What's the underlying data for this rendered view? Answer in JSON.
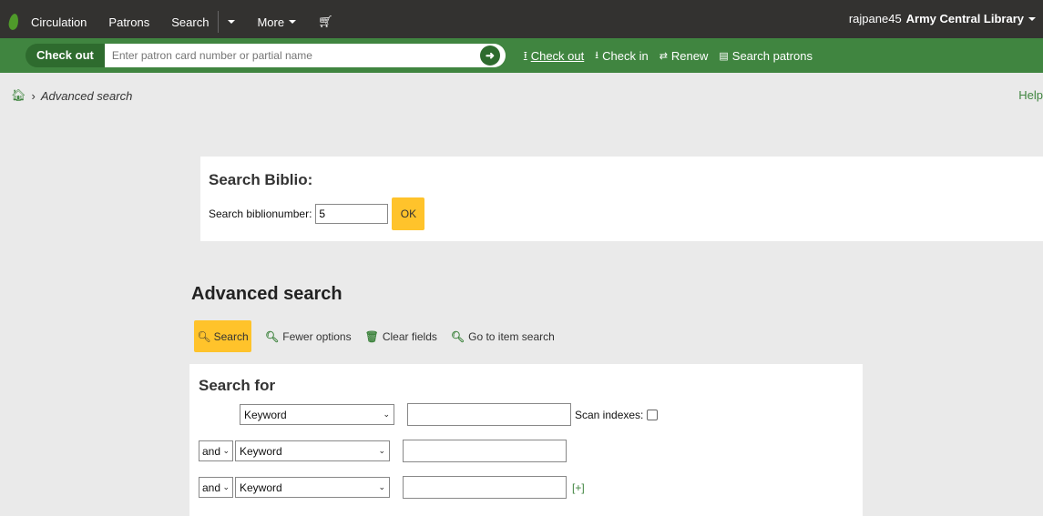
{
  "topnav": {
    "items": [
      {
        "label": "Circulation"
      },
      {
        "label": "Patrons"
      },
      {
        "label": "Search"
      }
    ],
    "more_label": "More",
    "user": "rajpane45",
    "library": "Army Central Library"
  },
  "checkout_bar": {
    "label": "Check out",
    "placeholder": "Enter patron card number or partial name",
    "links": [
      {
        "label": "Check out",
        "icon": "upload-icon"
      },
      {
        "label": "Check in",
        "icon": "download-icon"
      },
      {
        "label": "Renew",
        "icon": "renew-icon"
      },
      {
        "label": "Search patrons",
        "icon": "id-card-icon"
      }
    ]
  },
  "breadcrumb": {
    "current": "Advanced search"
  },
  "help_label": "Help",
  "biblio": {
    "title": "Search Biblio:",
    "label": "Search biblionumber:",
    "value": "5",
    "ok_label": "OK"
  },
  "advanced": {
    "title": "Advanced search",
    "search_label": "Search",
    "fewer_label": "Fewer options",
    "clear_label": "Clear fields",
    "item_search_label": "Go to item search",
    "search_for_title": "Search for",
    "rows": [
      {
        "op": "",
        "field": "Keyword"
      },
      {
        "op": "and",
        "field": "Keyword"
      },
      {
        "op": "and",
        "field": "Keyword"
      }
    ],
    "scan_label": "Scan indexes:",
    "add_label": "[+]"
  },
  "colors": {
    "green": "#408540",
    "yellow": "#ffc32b",
    "dark": "#333230"
  }
}
